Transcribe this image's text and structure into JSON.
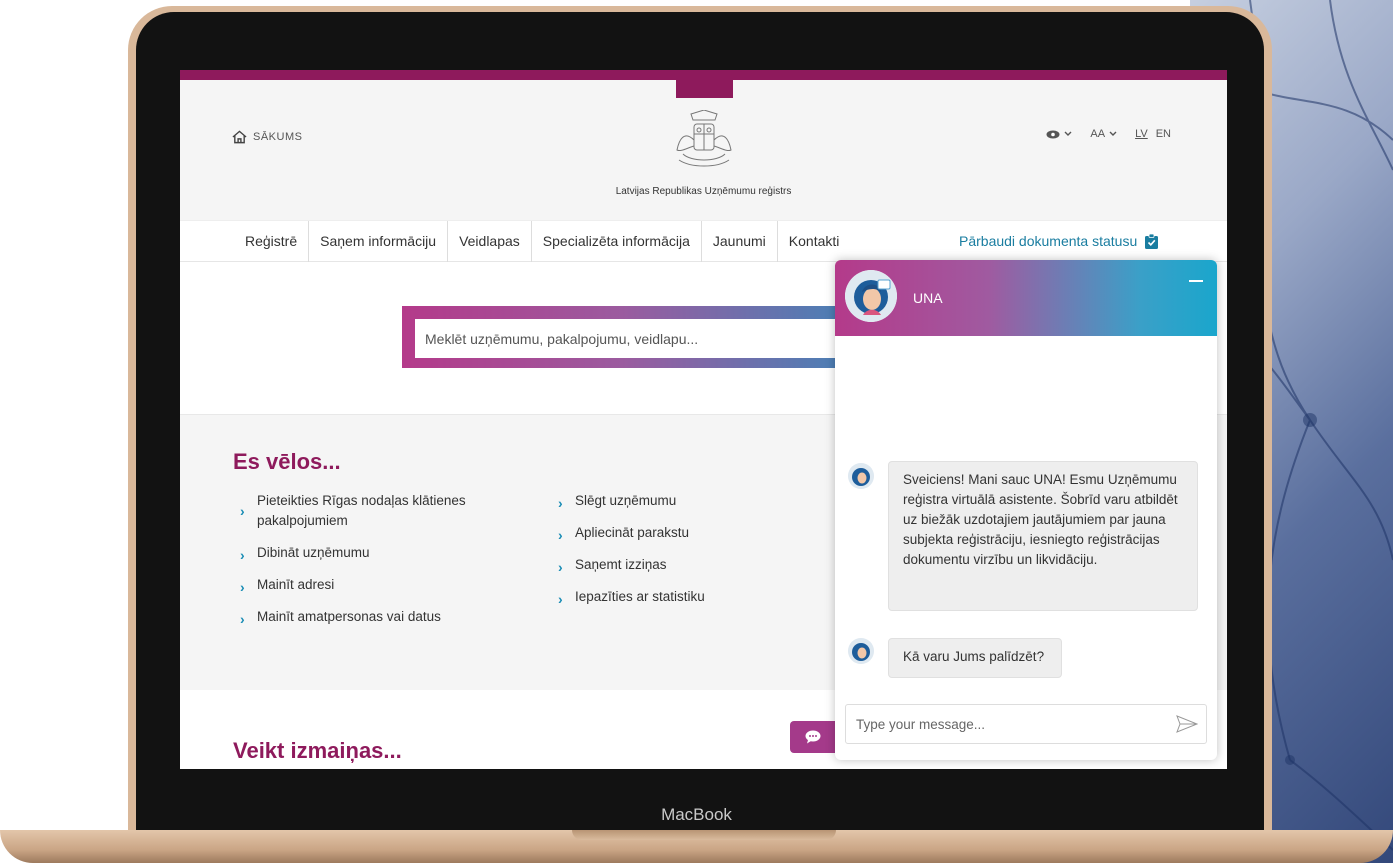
{
  "device": {
    "brand_label": "MacBook"
  },
  "header": {
    "home_label": "SĀKUMS",
    "org_name": "Latvijas Republikas Uzņēmumu reģistrs",
    "tools": {
      "contrast_icon": "eye-icon",
      "font_size_label": "AA",
      "lang_lv": "LV",
      "lang_en": "EN"
    }
  },
  "nav": {
    "items": [
      {
        "label": "Reģistrē"
      },
      {
        "label": "Saņem informāciju"
      },
      {
        "label": "Veidlapas"
      },
      {
        "label": "Specializēta informācija"
      },
      {
        "label": "Jaunumi"
      },
      {
        "label": "Kontakti"
      }
    ],
    "status_link": "Pārbaudi dokumenta statusu"
  },
  "search": {
    "placeholder": "Meklēt uzņēmumu, pakalpojumu, veidlapu..."
  },
  "want": {
    "title": "Es vēlos...",
    "col1": [
      {
        "label": "Pieteikties Rīgas nodaļas klātienes pakalpojumiem"
      },
      {
        "label": "Dibināt uzņēmumu"
      },
      {
        "label": "Mainīt adresi"
      },
      {
        "label": "Mainīt amatpersonas vai datus"
      }
    ],
    "col2": [
      {
        "label": "Slēgt uzņēmumu"
      },
      {
        "label": "Apliecināt parakstu"
      },
      {
        "label": "Saņemt izziņas"
      },
      {
        "label": "Iepazīties ar statistiku"
      }
    ]
  },
  "changes": {
    "title": "Veikt izmaiņas..."
  },
  "chat": {
    "assistant_name": "UNA",
    "messages": [
      {
        "text": "Sveiciens! Mani sauc UNA! Esmu Uzņēmumu reģistra virtuālā asistente. Šobrīd varu atbildēt uz biežāk uzdotajiem jautājumiem par jauna subjekta reģistrāciju, iesniegto reģistrācijas dokumentu virzību un likvidāciju."
      },
      {
        "text": "Kā varu Jums palīdzēt?"
      }
    ],
    "input_placeholder": "Type your message..."
  },
  "colors": {
    "brand": "#8e1a5c",
    "link": "#1a7da0",
    "chevron": "#1a8db5",
    "gradient_start": "#b43a8a",
    "gradient_end": "#1aa6cc"
  }
}
